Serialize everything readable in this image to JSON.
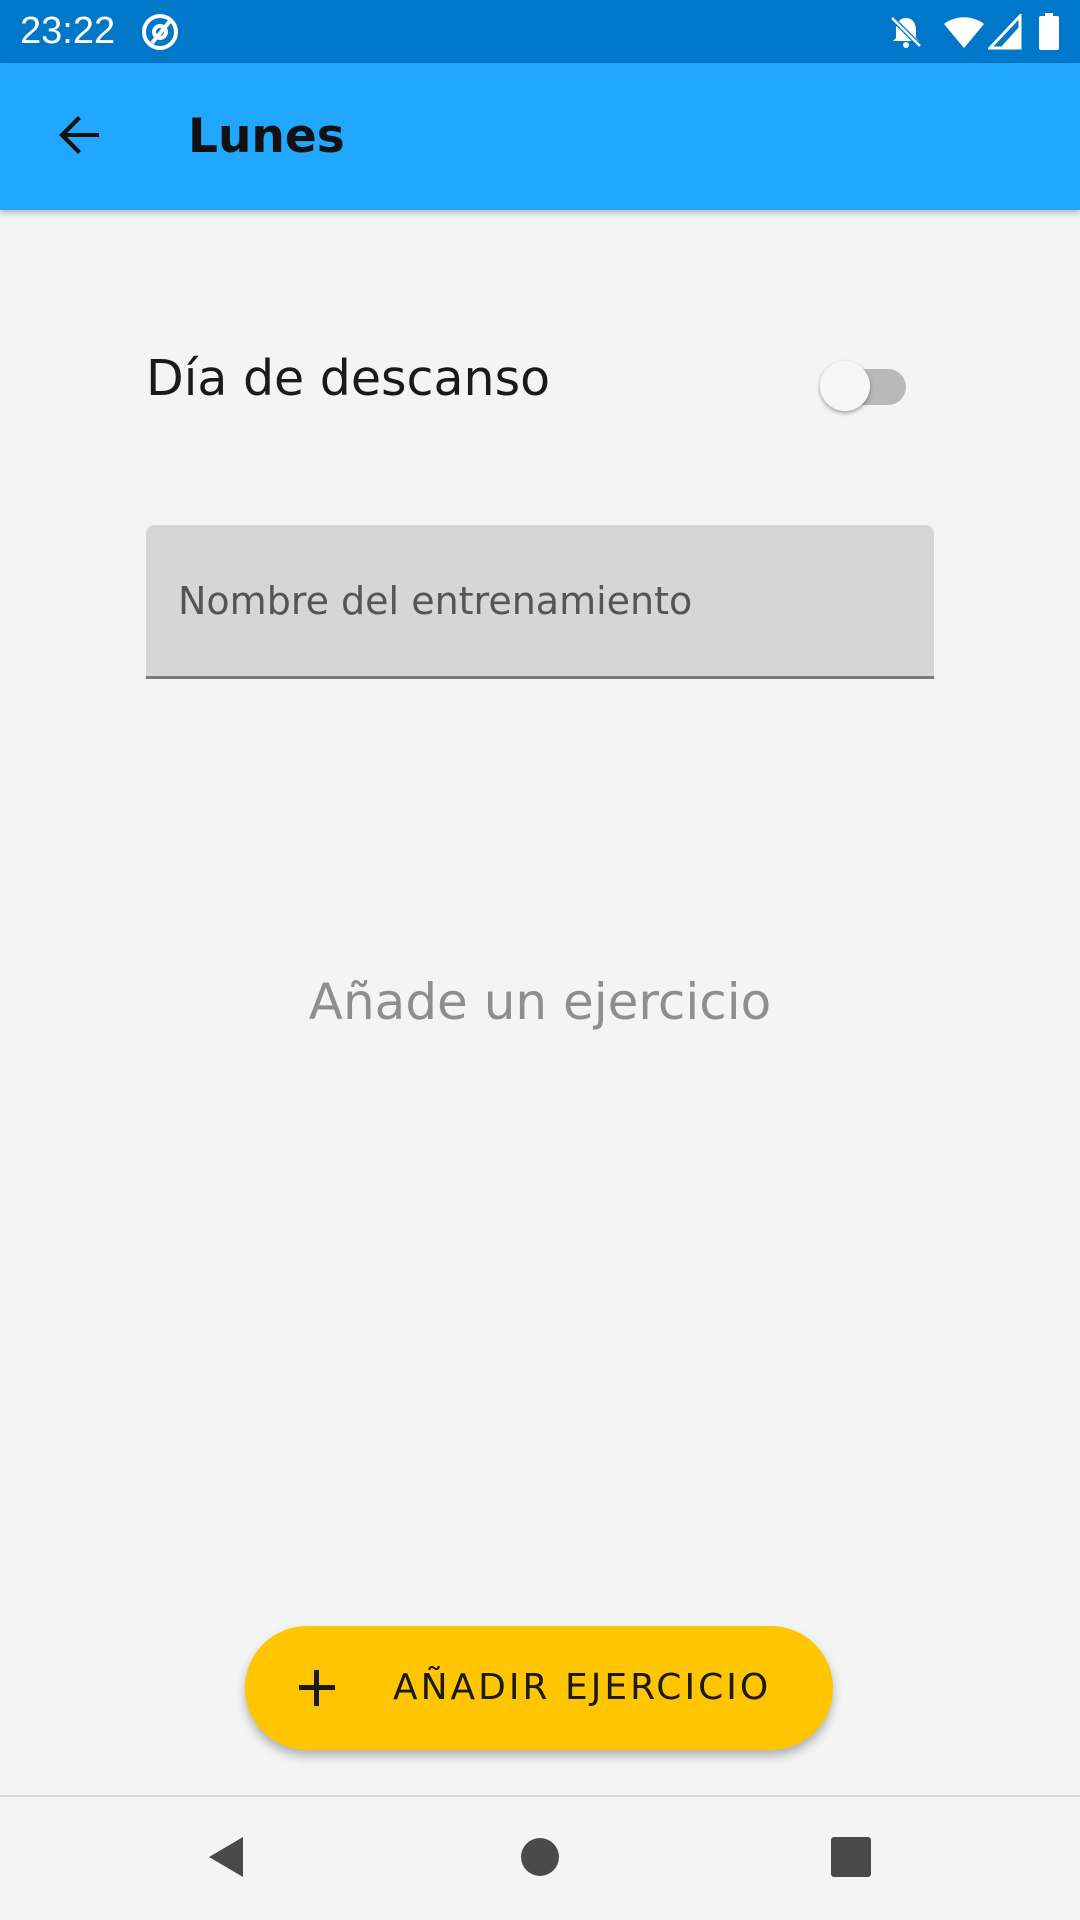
{
  "status_bar": {
    "time": "23:22",
    "icons": [
      "at-sign-icon",
      "notifications-off-icon",
      "wifi-icon",
      "cell-signal-icon",
      "battery-icon"
    ],
    "background": "#0077c8"
  },
  "app_bar": {
    "title": "Lunes",
    "back_icon": "arrow-back-icon",
    "background": "#22a7fe"
  },
  "rest_day": {
    "label": "Día de descanso",
    "enabled": false
  },
  "workout_name": {
    "placeholder": "Nombre del entrenamiento",
    "value": ""
  },
  "empty_state": {
    "message": "Añade un ejercicio"
  },
  "fab": {
    "label": "AÑADIR EJERCICIO",
    "icon": "plus-icon",
    "color": "#ffc500"
  },
  "nav_bar": {
    "buttons": [
      "back-triangle-icon",
      "home-circle-icon",
      "recents-square-icon"
    ]
  }
}
